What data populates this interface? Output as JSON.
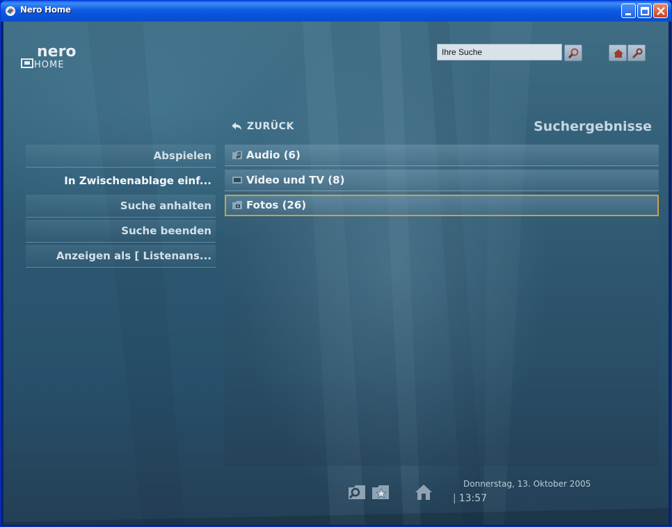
{
  "window": {
    "title": "Nero Home"
  },
  "header": {
    "search": {
      "value": "Ihre Suche"
    }
  },
  "nav": {
    "back_label": "ZURÜCK",
    "page_title": "Suchergebnisse"
  },
  "sidebar": {
    "items": [
      {
        "label": "Abspielen"
      },
      {
        "label": "In Zwischenablage einf..."
      },
      {
        "label": "Suche anhalten"
      },
      {
        "label": "Suche beenden"
      },
      {
        "label": "Anzeigen als [ Listenans..."
      }
    ]
  },
  "results": [
    {
      "label": "Audio (6)",
      "icon": "audio-folder-icon"
    },
    {
      "label": "Video und TV (8)",
      "icon": "video-folder-icon"
    },
    {
      "label": "Fotos (26)",
      "icon": "photo-folder-icon",
      "selected": true
    }
  ],
  "footer": {
    "date": "Donnerstag, 13. Oktober 2005",
    "time": "13:57"
  },
  "colors": {
    "selection_border": "#c9a24a",
    "titlebar": "#0a5de3"
  }
}
